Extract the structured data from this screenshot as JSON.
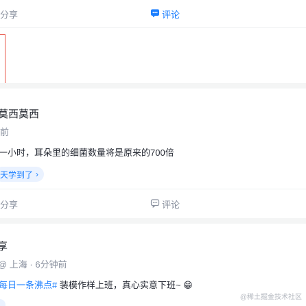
{
  "post1": {
    "share_label": "分享",
    "comment_label": "评论"
  },
  "post2": {
    "author": "莫西莫西",
    "time": "前",
    "content": "一小时，耳朵里的细菌数量将是原来的700倍",
    "topic": "天学到了",
    "topic_chevron": "›",
    "share_label": "分享",
    "comment_label": "评论"
  },
  "post3": {
    "author": "享",
    "meta": "@ 上海 · 6分钟前",
    "hashtag": "每日一条沸点#",
    "content": " 装模作样上班，真心实意下班~ ",
    "emoji": "😁"
  },
  "watermark": "@稀土掘金技术社区",
  "colors": {
    "accent": "#1e80ff",
    "muted": "#8a919f",
    "topic_bg": "#eaf2ff",
    "separator": "#f4f5f5"
  }
}
